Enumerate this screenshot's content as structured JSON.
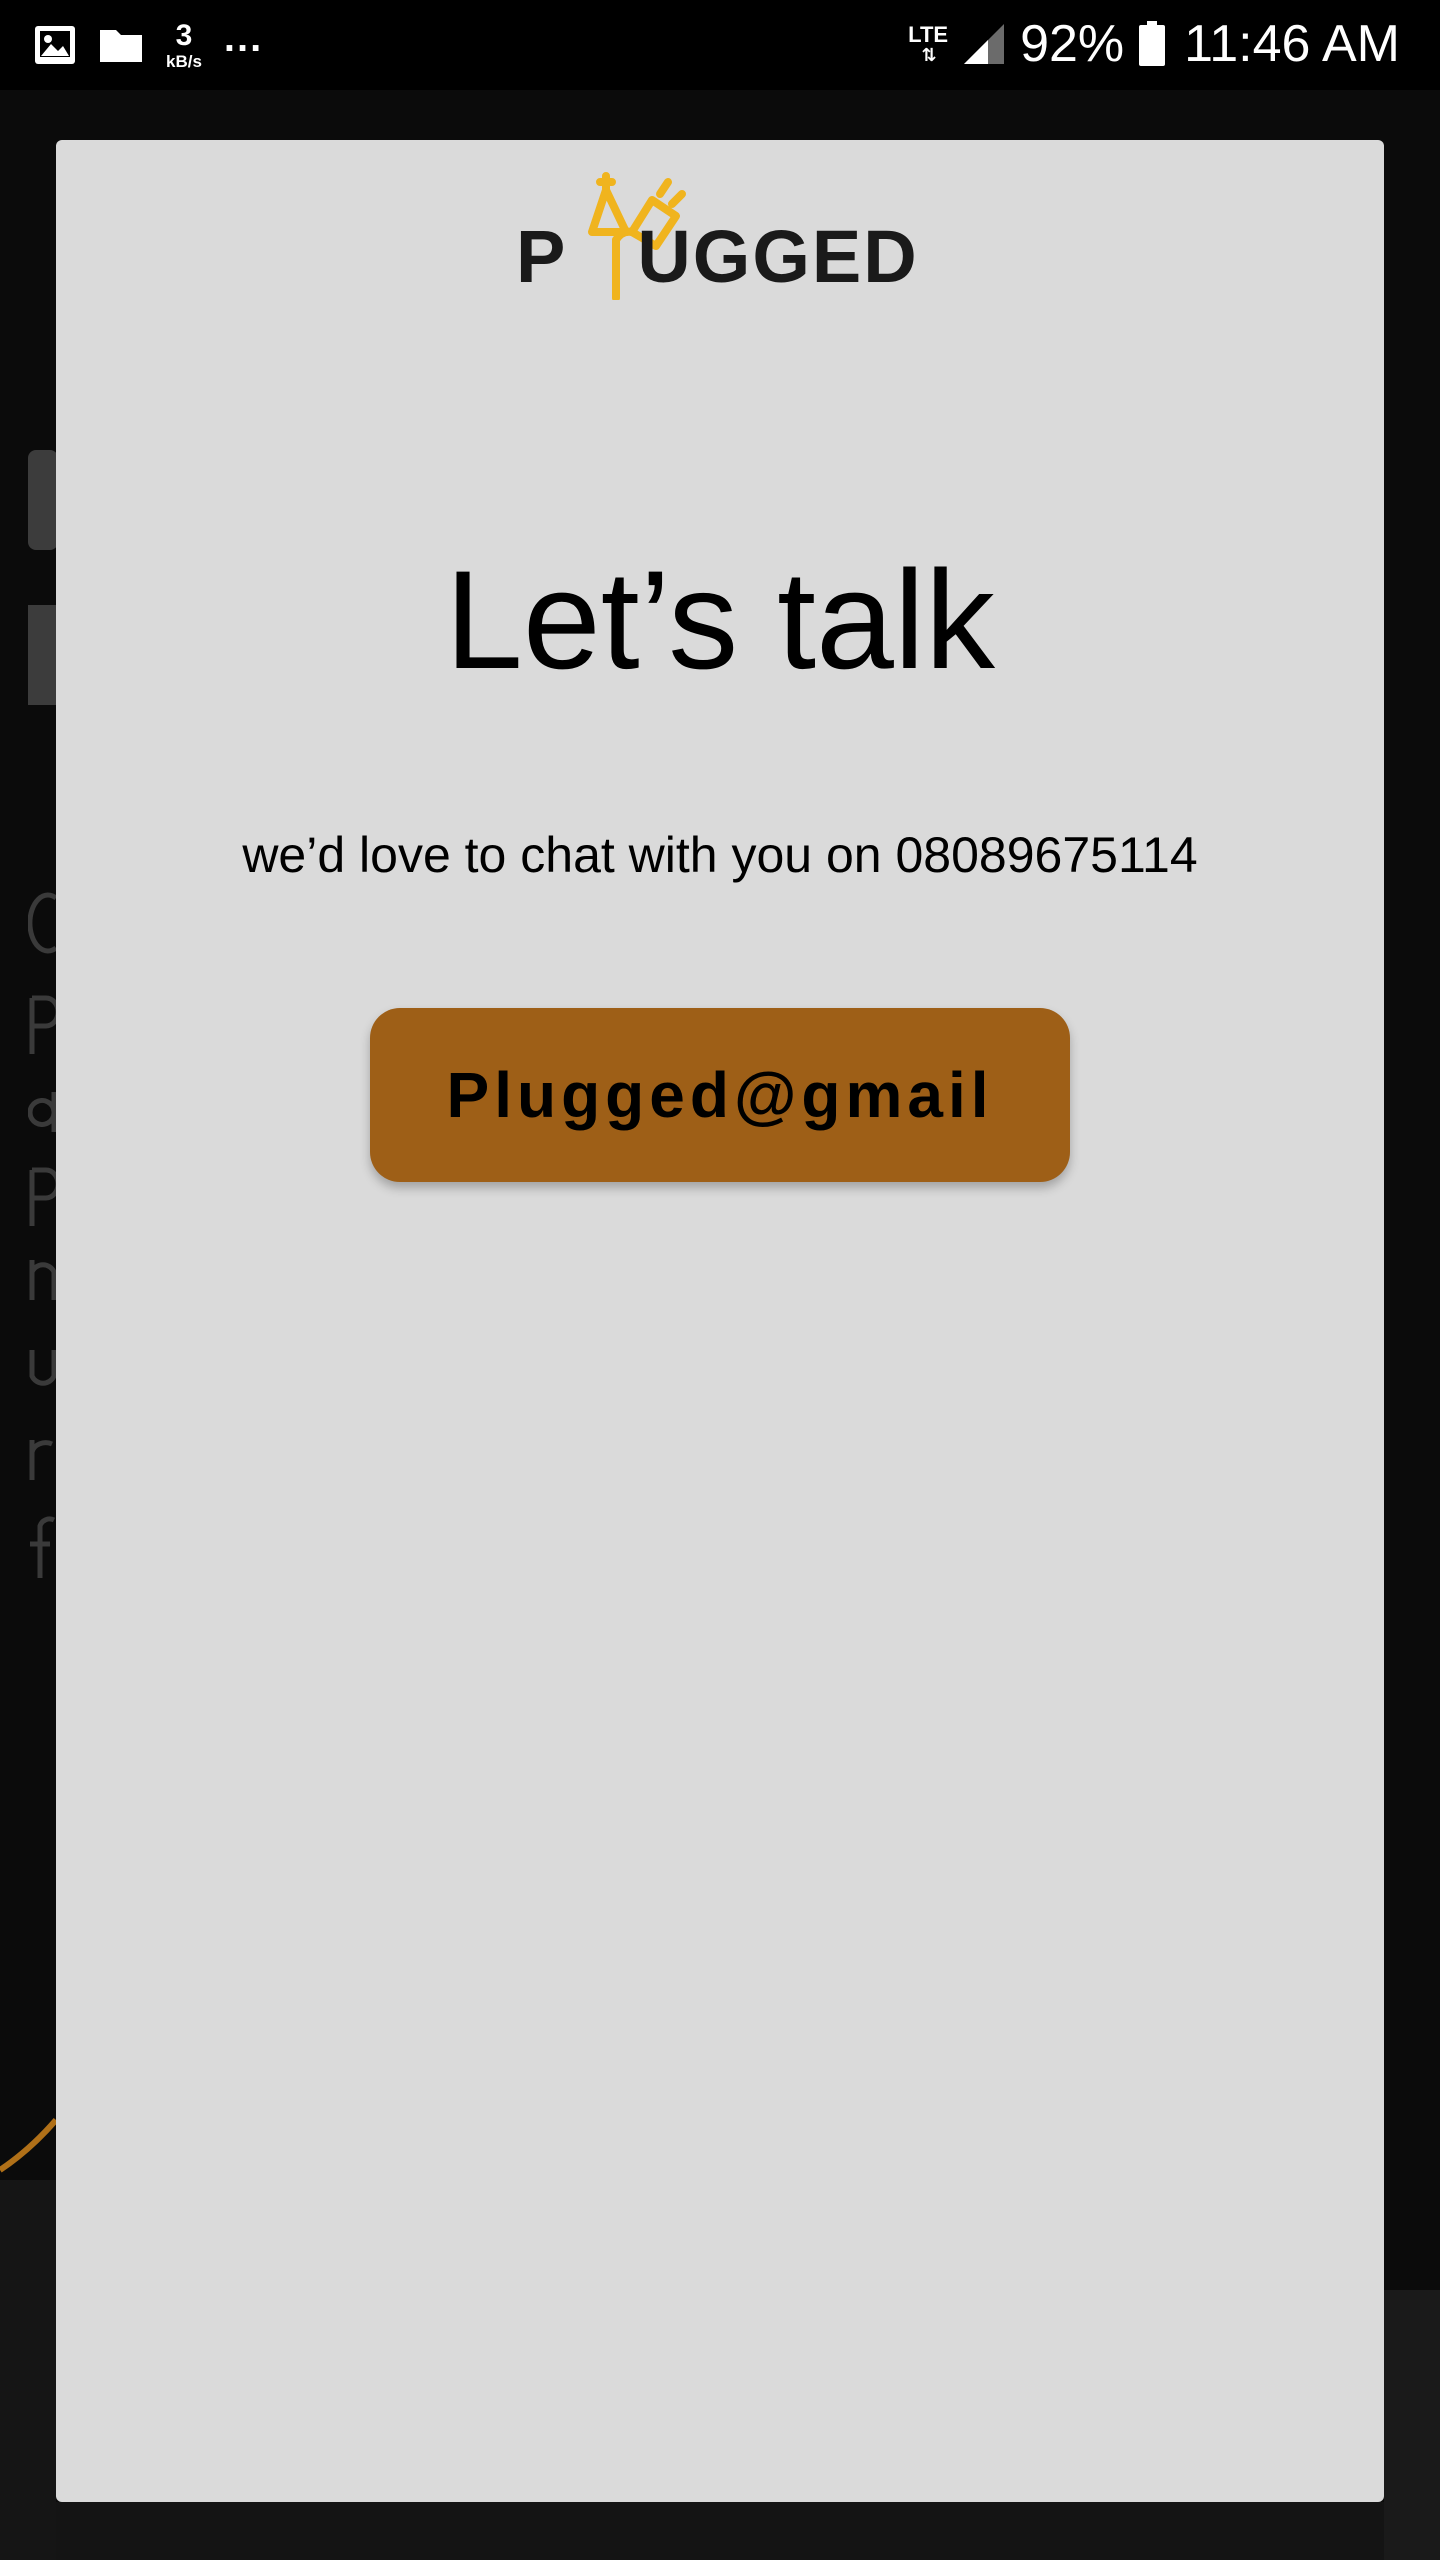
{
  "status_bar": {
    "icons_left": [
      "image-icon",
      "folder-icon"
    ],
    "net_speed_value": "3",
    "net_speed_unit": "kB/s",
    "overflow": "...",
    "network_type": "LTE",
    "network_arrows": "⇅",
    "battery_percent": "92%",
    "time": "11:46 AM"
  },
  "modal": {
    "logo_text_p": "P",
    "logo_text_rest": "UGGED",
    "title": "Let’s talk",
    "subtitle": "we’d love to chat with you on 08089675114",
    "email_button_label": "Plugged@gmail"
  },
  "colors": {
    "modal_background": "#dadada",
    "button_background": "#9e5f17",
    "logo_accent": "#f0b41e",
    "page_background": "#000000"
  }
}
